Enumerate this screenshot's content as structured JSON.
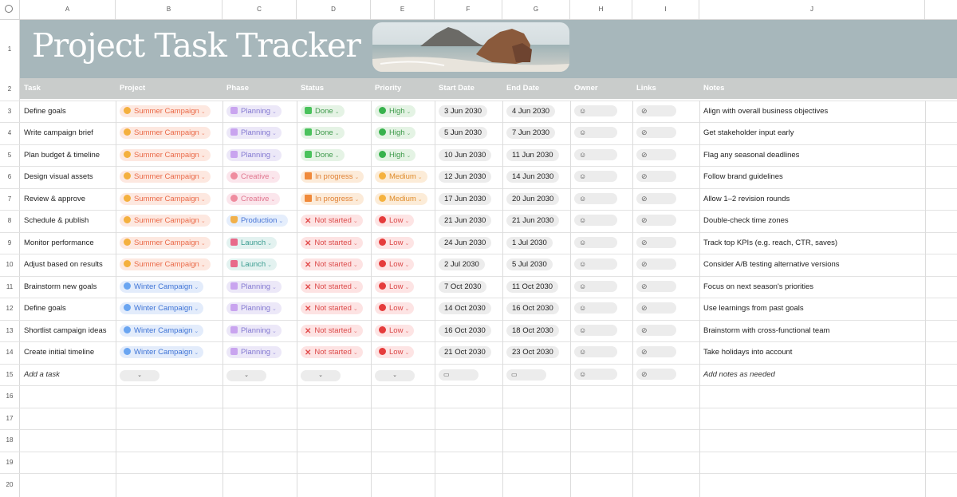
{
  "columns": [
    "A",
    "B",
    "C",
    "D",
    "E",
    "F",
    "G",
    "H",
    "I",
    "J"
  ],
  "banner": {
    "title": "Project Task Tracker",
    "background": "#a7b7bb"
  },
  "headers": {
    "task": "Task",
    "project": "Project",
    "phase": "Phase",
    "status": "Status",
    "priority": "Priority",
    "start": "Start Date",
    "end": "End Date",
    "owner": "Owner",
    "links": "Links",
    "notes": "Notes"
  },
  "row_numbers": [
    "1",
    "2",
    "3",
    "4",
    "5",
    "6",
    "7",
    "8",
    "9",
    "10",
    "11",
    "12",
    "13",
    "14",
    "15",
    "16",
    "17",
    "18",
    "19",
    "20"
  ],
  "tasks": [
    {
      "task": "Define goals",
      "project": "Summer Campaign",
      "project_kind": "summer",
      "phase": "Planning",
      "phase_kind": "planning",
      "status": "Done",
      "status_kind": "done",
      "priority": "High",
      "priority_kind": "high",
      "start": "3 Jun 2030",
      "end": "4 Jun 2030",
      "notes": "Align with overall business objectives"
    },
    {
      "task": "Write campaign brief",
      "project": "Summer Campaign",
      "project_kind": "summer",
      "phase": "Planning",
      "phase_kind": "planning",
      "status": "Done",
      "status_kind": "done",
      "priority": "High",
      "priority_kind": "high",
      "start": "5 Jun 2030",
      "end": "7 Jun 2030",
      "notes": "Get stakeholder input early"
    },
    {
      "task": "Plan budget & timeline",
      "project": "Summer Campaign",
      "project_kind": "summer",
      "phase": "Planning",
      "phase_kind": "planning",
      "status": "Done",
      "status_kind": "done",
      "priority": "High",
      "priority_kind": "high",
      "start": "10 Jun 2030",
      "end": "11 Jun 2030",
      "notes": "Flag any seasonal deadlines"
    },
    {
      "task": "Design visual assets",
      "project": "Summer Campaign",
      "project_kind": "summer",
      "phase": "Creative",
      "phase_kind": "creative",
      "status": "In progress",
      "status_kind": "progress",
      "priority": "Medium",
      "priority_kind": "medium",
      "start": "12 Jun 2030",
      "end": "14 Jun 2030",
      "notes": "Follow brand guidelines"
    },
    {
      "task": "Review & approve",
      "project": "Summer Campaign",
      "project_kind": "summer",
      "phase": "Creative",
      "phase_kind": "creative",
      "status": "In progress",
      "status_kind": "progress",
      "priority": "Medium",
      "priority_kind": "medium",
      "start": "17 Jun 2030",
      "end": "20 Jun 2030",
      "notes": "Allow 1–2 revision rounds"
    },
    {
      "task": "Schedule & publish",
      "project": "Summer Campaign",
      "project_kind": "summer",
      "phase": "Production",
      "phase_kind": "production",
      "status": "Not started",
      "status_kind": "notstarted",
      "priority": "Low",
      "priority_kind": "low",
      "start": "21 Jun 2030",
      "end": "21 Jun 2030",
      "notes": "Double-check time zones"
    },
    {
      "task": "Monitor performance",
      "project": "Summer Campaign",
      "project_kind": "summer",
      "phase": "Launch",
      "phase_kind": "launch",
      "status": "Not started",
      "status_kind": "notstarted",
      "priority": "Low",
      "priority_kind": "low",
      "start": "24 Jun 2030",
      "end": "1 Jul 2030",
      "notes": "Track top KPIs (e.g. reach, CTR, saves)"
    },
    {
      "task": "Adjust based on results",
      "project": "Summer Campaign",
      "project_kind": "summer",
      "phase": "Launch",
      "phase_kind": "launch",
      "status": "Not started",
      "status_kind": "notstarted",
      "priority": "Low",
      "priority_kind": "low",
      "start": "2 Jul 2030",
      "end": "5 Jul 2030",
      "notes": "Consider A/B testing alternative versions"
    },
    {
      "task": "Brainstorm new goals",
      "project": "Winter Campaign",
      "project_kind": "winter",
      "phase": "Planning",
      "phase_kind": "planning",
      "status": "Not started",
      "status_kind": "notstarted",
      "priority": "Low",
      "priority_kind": "low",
      "start": "7 Oct 2030",
      "end": "11 Oct 2030",
      "notes": "Focus on next season's priorities"
    },
    {
      "task": "Define goals",
      "project": "Winter Campaign",
      "project_kind": "winter",
      "phase": "Planning",
      "phase_kind": "planning",
      "status": "Not started",
      "status_kind": "notstarted",
      "priority": "Low",
      "priority_kind": "low",
      "start": "14 Oct 2030",
      "end": "16 Oct 2030",
      "notes": "Use learnings from past goals"
    },
    {
      "task": "Shortlist campaign ideas",
      "project": "Winter Campaign",
      "project_kind": "winter",
      "phase": "Planning",
      "phase_kind": "planning",
      "status": "Not started",
      "status_kind": "notstarted",
      "priority": "Low",
      "priority_kind": "low",
      "start": "16 Oct 2030",
      "end": "18 Oct 2030",
      "notes": "Brainstorm with cross-functional team"
    },
    {
      "task": "Create initial timeline",
      "project": "Winter Campaign",
      "project_kind": "winter",
      "phase": "Planning",
      "phase_kind": "planning",
      "status": "Not started",
      "status_kind": "notstarted",
      "priority": "Low",
      "priority_kind": "low",
      "start": "21 Oct 2030",
      "end": "23 Oct 2030",
      "notes": "Take holidays into account"
    }
  ],
  "add_row": {
    "task": "Add a task",
    "notes": "Add notes as needed"
  },
  "icons": {
    "owner": "person-icon",
    "links": "link-icon",
    "date": "calendar-icon",
    "dropdown": "chevron-down-icon"
  },
  "colors": {
    "header_row": "#c9cccb",
    "banner": "#a7b7bb"
  }
}
